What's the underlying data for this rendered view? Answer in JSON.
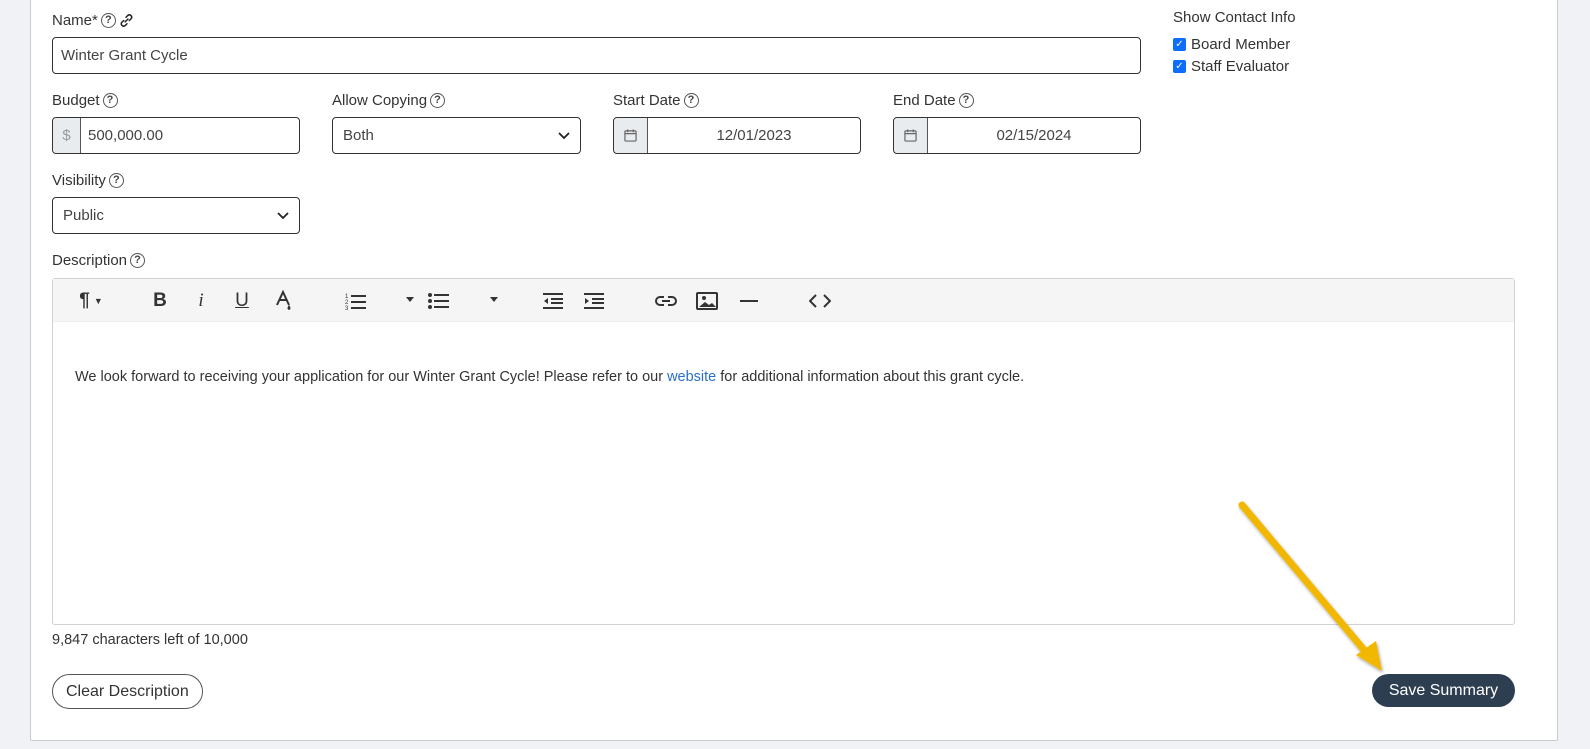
{
  "form": {
    "name_label": "Name*",
    "name_value": "Winter Grant Cycle",
    "budget_label": "Budget",
    "budget_prefix": "$",
    "budget_value": "500,000.00",
    "copying_label": "Allow Copying",
    "copying_value": "Both",
    "start_label": "Start Date",
    "start_value": "12/01/2023",
    "end_label": "End Date",
    "end_value": "02/15/2024",
    "visibility_label": "Visibility",
    "visibility_value": "Public",
    "description_label": "Description",
    "help_glyph": "?"
  },
  "contact": {
    "heading": "Show Contact Info",
    "options": [
      {
        "label": "Board Member",
        "checked": true
      },
      {
        "label": "Staff Evaluator",
        "checked": true
      }
    ]
  },
  "editor": {
    "text_before": "We look forward to receiving your application for our Winter Grant Cycle! Please refer to our ",
    "link_text": "website",
    "text_after": " for additional information about this grant cycle.",
    "toolbar_icons": [
      "paragraph-icon",
      "bold-icon",
      "italic-icon",
      "underline-icon",
      "text-color-icon",
      "ordered-list-icon",
      "unordered-list-icon",
      "outdent-icon",
      "indent-icon",
      "link-icon",
      "image-icon",
      "horizontal-rule-icon",
      "code-view-icon"
    ]
  },
  "counter": "9,847 characters left of 10,000",
  "buttons": {
    "clear": "Clear Description",
    "save": "Save Summary"
  },
  "colors": {
    "accent_dark": "#2c3e50",
    "link": "#2a6fc9",
    "arrow": "#f2b705",
    "checkbox": "#0d6efd"
  }
}
